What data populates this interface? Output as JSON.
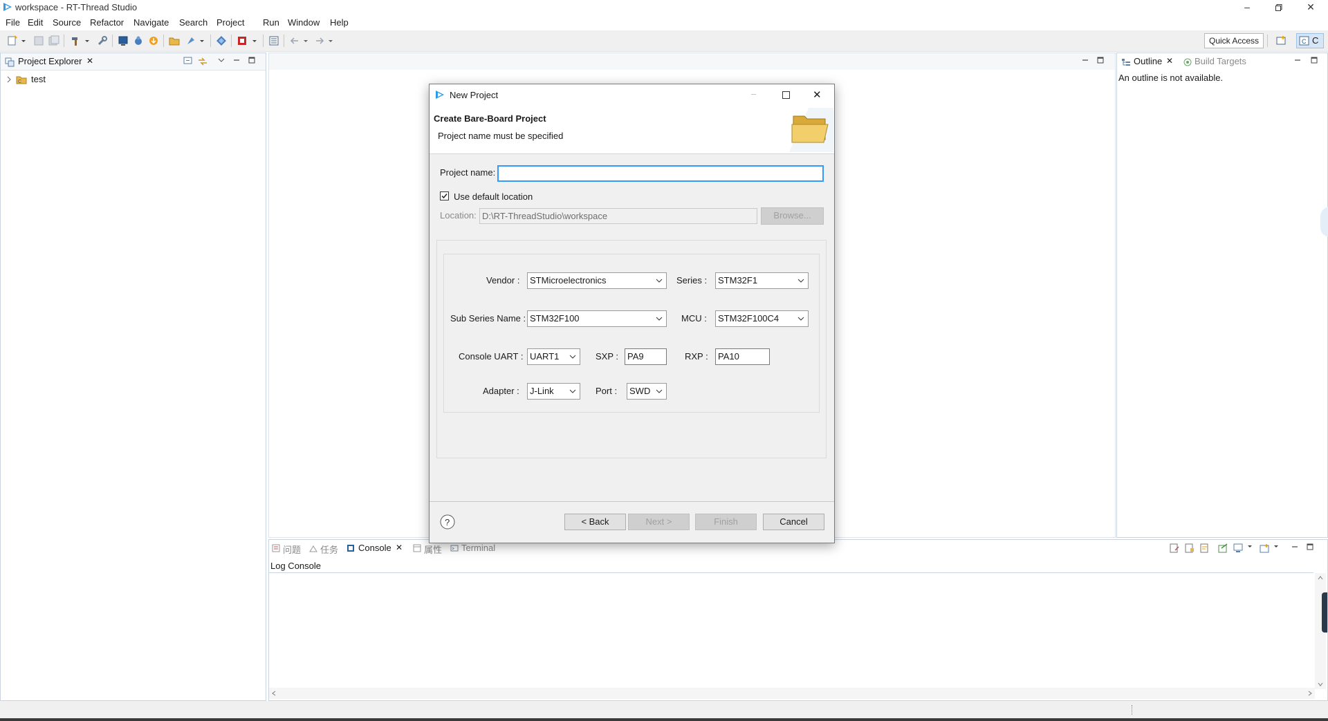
{
  "window": {
    "title": "workspace - RT-Thread Studio"
  },
  "menu": [
    "File",
    "Edit",
    "Source",
    "Refactor",
    "Navigate",
    "Search",
    "Project",
    "Run",
    "Window",
    "Help"
  ],
  "toolbar": {
    "quick_access": "Quick Access",
    "perspective_label": "C"
  },
  "project_explorer": {
    "tab_label": "Project Explorer",
    "items": [
      {
        "label": "test"
      }
    ]
  },
  "outline": {
    "tab_label": "Outline",
    "tab2_label": "Build Targets",
    "message": "An outline is not available."
  },
  "bottom": {
    "tabs": [
      "问题",
      "任务",
      "Console",
      "属性",
      "Terminal"
    ],
    "console_title": "Log Console"
  },
  "dialog": {
    "title": "New Project",
    "header_title": "Create Bare-Board Project",
    "header_message": "Project name must be specified",
    "project_name_label": "Project name:",
    "project_name_value": "",
    "use_default_location_label": "Use default location",
    "use_default_location_checked": true,
    "location_label": "Location:",
    "location_value": "D:\\RT-ThreadStudio\\workspace",
    "browse_label": "Browse...",
    "vendor_label": "Vendor :",
    "vendor_value": "STMicroelectronics",
    "series_label": "Series :",
    "series_value": "STM32F1",
    "sub_series_label": "Sub Series Name :",
    "sub_series_value": "STM32F100",
    "mcu_label": "MCU :",
    "mcu_value": "STM32F100C4",
    "console_uart_label": "Console UART :",
    "console_uart_value": "UART1",
    "sxp_label": "SXP :",
    "sxp_value": "PA9",
    "rxp_label": "RXP :",
    "rxp_value": "PA10",
    "adapter_label": "Adapter :",
    "adapter_value": "J-Link",
    "port_label": "Port :",
    "port_value": "SWD",
    "back_label": "< Back",
    "next_label": "Next >",
    "finish_label": "Finish",
    "cancel_label": "Cancel"
  },
  "colors": {
    "accent": "#0078d7",
    "focus_border": "#3399ff",
    "panel_border": "#c9d4e0"
  }
}
